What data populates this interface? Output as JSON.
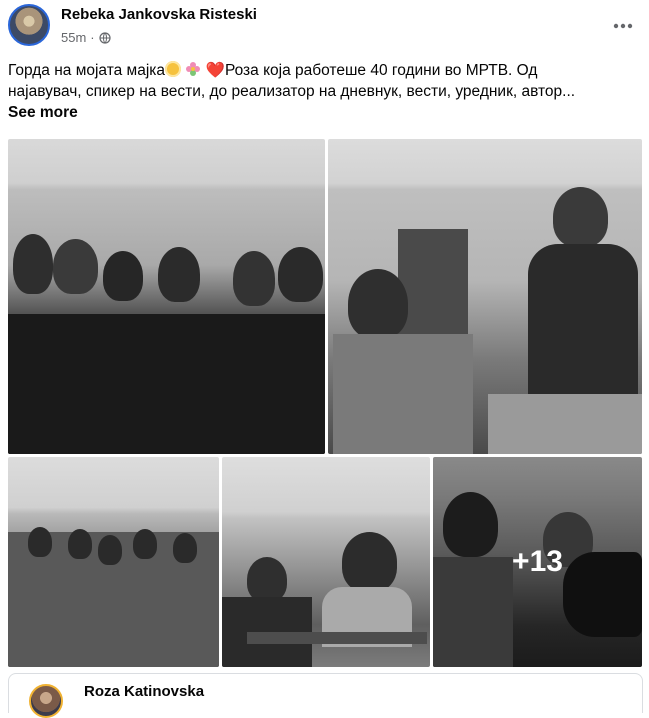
{
  "post": {
    "author": "Rebeka Jankovska Risteski",
    "time": "55m",
    "audience_icon": "globe-icon",
    "text_line1_a": "Горда на мојата мајка",
    "text_line1_b": "Роза која работеше 40 години во МРТВ. Од",
    "text_line2": "најавувач, спикер на вести, до реализатор на дневнук, вести, уредник, автор...",
    "see_more": "See more",
    "emojis": [
      "sun-emoji",
      "flower-emoji",
      "heart-emoji"
    ]
  },
  "photos": {
    "extra_count": "+13",
    "items": [
      "photo-group-party",
      "photo-radio-studio",
      "photo-women-uniforms",
      "photo-office-kiss",
      "photo-camera-operator"
    ]
  },
  "shared_post": {
    "author": "Roza Katinovska"
  },
  "colors": {
    "accent": "#2a66d9",
    "heart": "#e0245e",
    "meta": "#65676b"
  }
}
